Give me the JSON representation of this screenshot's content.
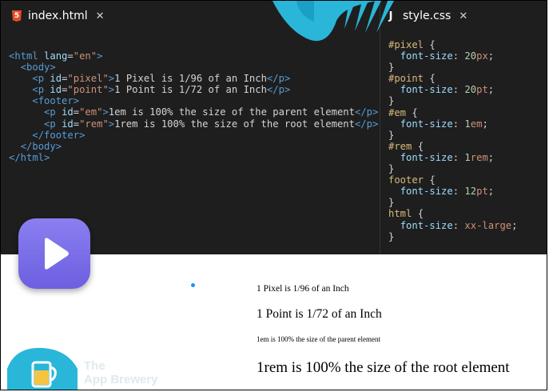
{
  "editor": {
    "left_tab": {
      "icon": "html5-icon",
      "icon_glyph": "5",
      "label": "index.html",
      "close": "✕"
    },
    "right_tab": {
      "icon": "js-icon",
      "icon_glyph": "J",
      "label": "style.css",
      "close": "✕"
    },
    "html_code": [
      "<html lang=\"en\">",
      "  <body>",
      "    <p id=\"pixel\">1 Pixel is 1/96 of an Inch</p>",
      "    <p id=\"point\">1 Point is 1/72 of an Inch</p>",
      "    <footer>",
      "      <p id=\"em\">1em is 100% the size of the parent element</p>",
      "      <p id=\"rem\">1rem is 100% the size of the root element</p>",
      "    </footer>",
      "  </body>",
      "</html>"
    ],
    "css_code": [
      "#pixel {",
      "  font-size: 20px;",
      "}",
      "#point {",
      "  font-size: 20pt;",
      "}",
      "#em {",
      "  font-size: 1em;",
      "}",
      "#rem {",
      "  font-size: 1rem;",
      "}",
      "footer {",
      "  font-size: 12pt;",
      "}",
      "html {",
      "  font-size: xx-large;",
      "}"
    ],
    "colors": {
      "background": "#1e1e1e",
      "tag": "#569cd6",
      "attribute": "#9cdcfe",
      "string": "#ce9178",
      "selector": "#d7ba7d",
      "number": "#b5cea8"
    }
  },
  "preview": {
    "pixel_text": "1 Pixel is 1/96 of an Inch",
    "point_text": "1 Point is 1/72 of an Inch",
    "em_text": "1em is 100% the size of the parent element",
    "rem_text": "1rem is 100% the size of the root element"
  },
  "overlay": {
    "play_icon": "play-icon",
    "logo_line1": "The",
    "logo_line2": "App Brewery",
    "accent": "#6f63e6",
    "brand_teal": "#29b6d8"
  }
}
